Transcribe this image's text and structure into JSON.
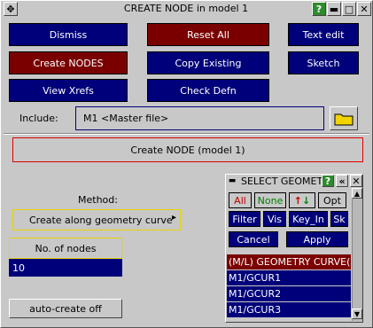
{
  "window": {
    "title": "CREATE NODE in model 1",
    "move_glyph": "✥",
    "help_glyph": "?",
    "minimize_glyph": "▬",
    "maximize_glyph": "□",
    "close_glyph": "✕"
  },
  "buttons": {
    "dismiss": "Dismiss",
    "reset_all": "Reset All",
    "text_edit": "Text edit",
    "create_nodes": "Create NODES",
    "copy_existing": "Copy Existing",
    "sketch": "Sketch",
    "view_xrefs": "View Xrefs",
    "check_defn": "Check Defn"
  },
  "include": {
    "label": "Include:",
    "value": "M1  <Master file>",
    "folder_icon": "folder-icon"
  },
  "header_box": {
    "text": "Create NODE (model 1)"
  },
  "method": {
    "label": "Method:",
    "value": "Create along geometry curve",
    "arrow_glyph": "▸"
  },
  "nodes": {
    "label": "No. of nodes",
    "value": "10"
  },
  "auto_create": {
    "label": "auto-create off"
  },
  "select_geom": {
    "title": "SELECT GEOMET",
    "help_glyph": "?",
    "collapse_glyph": "«",
    "all": "All",
    "none": "None",
    "swap_up": "↑",
    "swap_down": "↓",
    "opt": "Opt",
    "filter": "Filter",
    "vis": "Vis",
    "key_in": "Key_In",
    "sk": "Sk",
    "cancel": "Cancel",
    "apply": "Apply",
    "list_header": "(M/L) GEOMETRY CURVE(s",
    "items": [
      "M1/GCUR1",
      "M1/GCUR2",
      "M1/GCUR3"
    ]
  },
  "colors": {
    "navy": "#00007a",
    "dark_red": "#7a0000",
    "panel_grey": "#c8c8c8",
    "help_green": "#2e8b2e",
    "yellow_border": "#e6d400"
  }
}
